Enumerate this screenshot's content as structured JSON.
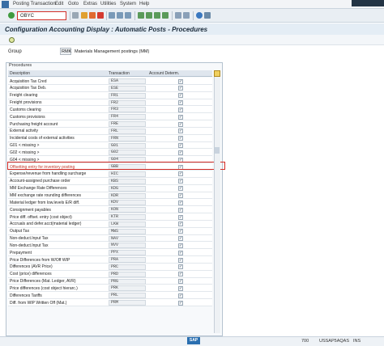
{
  "menu": [
    "Posting Transaction",
    "Edit",
    "Goto",
    "Extras",
    "Utilities",
    "System",
    "Help"
  ],
  "command_field": "OBYC",
  "title": "Configuration Accounting Display : Automatic Posts - Procedures",
  "group": {
    "label": "Group",
    "code": "RMK",
    "description": "Materials Management postings (MM)"
  },
  "procedures": {
    "title": "Procedures",
    "columns": [
      "Description",
      "Transaction",
      "Account Determ."
    ],
    "rows": [
      {
        "desc": "Acquisition Tax Cred",
        "tx": "ESA"
      },
      {
        "desc": "Acquisition Tax Deb.",
        "tx": "ESE"
      },
      {
        "desc": "Freight clearing",
        "tx": "FR1"
      },
      {
        "desc": "Freight provisions",
        "tx": "FR2"
      },
      {
        "desc": "Customs clearing",
        "tx": "FR3"
      },
      {
        "desc": "Customs provisions",
        "tx": "FR4"
      },
      {
        "desc": "Purchasing freight account",
        "tx": "FRE"
      },
      {
        "desc": "External activity",
        "tx": "FRL"
      },
      {
        "desc": "Incidental costs of external activities",
        "tx": "FRN"
      },
      {
        "desc": "G01 < missing >",
        "tx": "G01"
      },
      {
        "desc": "G02 < missing >",
        "tx": "G02"
      },
      {
        "desc": "G04 < missing >",
        "tx": "G04"
      },
      {
        "desc": "Offsetting entry for inventory posting",
        "tx": "GBB"
      },
      {
        "desc": "Expense/revenue from handling surcharge",
        "tx": "HIC"
      },
      {
        "desc": "Account-assigned purchase order",
        "tx": "KBS"
      },
      {
        "desc": "MM Exchange Rate Differences",
        "tx": "KDG"
      },
      {
        "desc": "MM exchange rate rounding differences",
        "tx": "KDR"
      },
      {
        "desc": "Material ledger from low.levels E/R diff.",
        "tx": "KDV"
      },
      {
        "desc": "Consignment payables",
        "tx": "KON"
      },
      {
        "desc": "Price diff. offset. entry (cost object)",
        "tx": "KTR"
      },
      {
        "desc": "Accruals and defer.acct(material ledger)",
        "tx": "LKW"
      },
      {
        "desc": "Output Tax",
        "tx": "MWS"
      },
      {
        "desc": "Non-deduct.Input Tax",
        "tx": "NAV"
      },
      {
        "desc": "Non-deduct.Input Tax",
        "tx": "NVV"
      },
      {
        "desc": "Prepayment",
        "tx": "PPX"
      },
      {
        "desc": "Price Differences from W/Off WIP",
        "tx": "PRA"
      },
      {
        "desc": "Differences (AVR Price)",
        "tx": "PRC"
      },
      {
        "desc": "Cost (price) differences",
        "tx": "PRD"
      },
      {
        "desc": "Price Differences (Mat. Ledger, AVR)",
        "tx": "PRG"
      },
      {
        "desc": "Price differences (cost object hierarc.)",
        "tx": "PRK"
      },
      {
        "desc": "Differences Tariffs",
        "tx": "PRL"
      },
      {
        "desc": "Diff. from WIP Written Off (Mat.)",
        "tx": "PRM"
      }
    ],
    "check_mark": "✓"
  },
  "status": {
    "logo": "SAP",
    "session": "700",
    "server": "USSAP5AQAS",
    "mode": "INS"
  }
}
